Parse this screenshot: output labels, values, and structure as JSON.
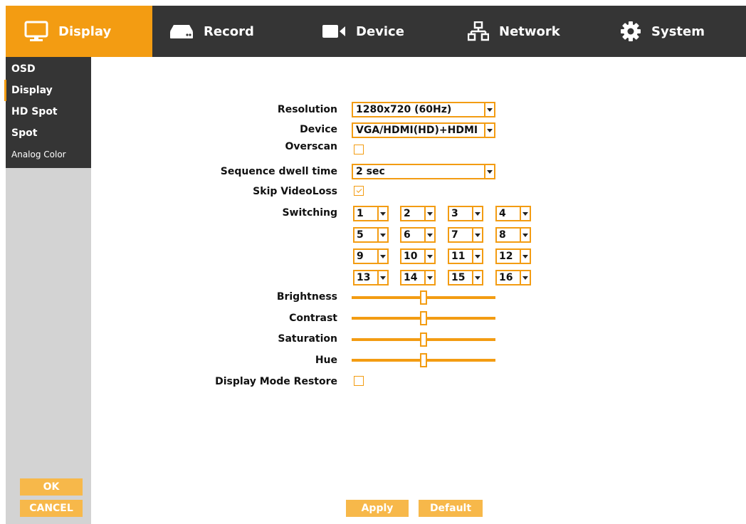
{
  "nav": {
    "tabs": [
      {
        "label": "Display",
        "icon": "monitor-icon",
        "active": true
      },
      {
        "label": "Record",
        "icon": "hard-drive-icon"
      },
      {
        "label": "Device",
        "icon": "video-camera-icon"
      },
      {
        "label": "Network",
        "icon": "network-icon"
      },
      {
        "label": "System",
        "icon": "gear-icon"
      }
    ]
  },
  "sidebar": {
    "items": [
      {
        "label": "OSD"
      },
      {
        "label": "Display",
        "active": true
      },
      {
        "label": "HD Spot"
      },
      {
        "label": "Spot"
      },
      {
        "label": "Analog Color"
      }
    ],
    "ok_label": "OK",
    "cancel_label": "CANCEL"
  },
  "form": {
    "resolution": {
      "label": "Resolution",
      "value": "1280x720 (60Hz)"
    },
    "device": {
      "label": "Device",
      "value": "VGA/HDMI(HD)+HDMI"
    },
    "overscan": {
      "label": "Overscan",
      "checked": false
    },
    "sequence_dwell": {
      "label": "Sequence dwell time",
      "value": "2 sec"
    },
    "skip_videoloss": {
      "label": "Skip VideoLoss",
      "checked": true
    },
    "switching": {
      "label": "Switching",
      "values": [
        "1",
        "2",
        "3",
        "4",
        "5",
        "6",
        "7",
        "8",
        "9",
        "10",
        "11",
        "12",
        "13",
        "14",
        "15",
        "16"
      ]
    },
    "brightness": {
      "label": "Brightness",
      "level": 0.5
    },
    "contrast": {
      "label": "Contrast",
      "level": 0.5
    },
    "saturation": {
      "label": "Saturation",
      "level": 0.5
    },
    "hue": {
      "label": "Hue",
      "level": 0.5
    },
    "display_mode_restore": {
      "label": "Display Mode Restore",
      "checked": false
    }
  },
  "actions": {
    "apply_label": "Apply",
    "default_label": "Default"
  },
  "colors": {
    "accent": "#f39c12",
    "button": "#f7b84a",
    "bar": "#353535",
    "sidebar": "#d3d3d3"
  }
}
